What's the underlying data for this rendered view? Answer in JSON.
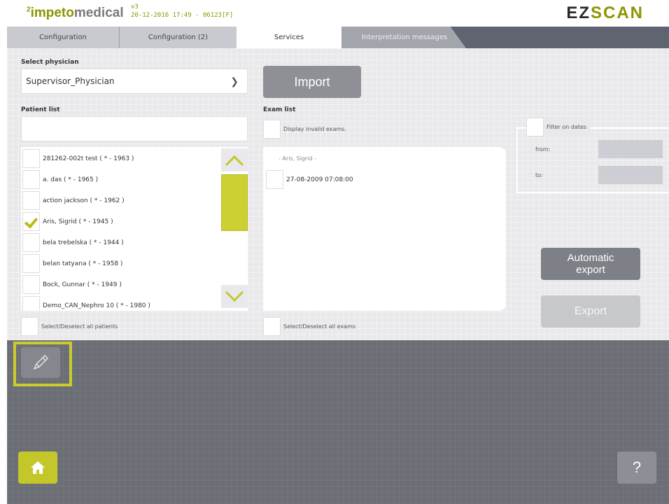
{
  "header": {
    "brand_super": "2",
    "brand_main": "impeto",
    "brand_tail": "medical",
    "version": "v3",
    "datetime": "20-12-2016 17:49  -  06123[F]",
    "product_ez": "EZ",
    "product_scan": "SCAN"
  },
  "tabs": [
    {
      "label": "Configuration",
      "active": false
    },
    {
      "label": "Configuration (2)",
      "active": false
    },
    {
      "label": "Services",
      "active": true
    },
    {
      "label": "Interpretation messages",
      "active": false
    }
  ],
  "physician": {
    "label": "Select physician",
    "value": "Supervisor_Physician"
  },
  "import_label": "Import",
  "patient_list": {
    "label": "Patient list",
    "search_value": "",
    "rows": [
      {
        "name": "281262-002t test ( * - 1963 )",
        "checked": false
      },
      {
        "name": "a. das  ( * - 1965 )",
        "checked": false
      },
      {
        "name": "action jackson  ( * - 1962 )",
        "checked": false
      },
      {
        "name": "Aris, Sigrid  ( * - 1945 )",
        "checked": true
      },
      {
        "name": "bela trebelska  ( * - 1944 )",
        "checked": false
      },
      {
        "name": "belan tatyana  ( * - 1958 )",
        "checked": false
      },
      {
        "name": "Bock, Gunnar  ( * - 1949 )",
        "checked": false
      },
      {
        "name": "Demo_CAN_Nephro 10 ( * - 1980 )",
        "checked": false
      }
    ],
    "select_all": "Select/Deselect all patients"
  },
  "exam_list": {
    "label": "Exam list",
    "invalid_label": "Display invalid exams.",
    "group": "- Aris, Sigrid  -",
    "exams": [
      {
        "date": "27-08-2009 07:08:00",
        "checked": false
      }
    ],
    "select_all": "Select/Deselect all exams"
  },
  "filter": {
    "label": "Filter on dates",
    "from_label": "from:",
    "to_label": "to:",
    "from_value": "",
    "to_value": ""
  },
  "auto_export_label": "Automatic\nexport",
  "export_label": "Export",
  "help_label": "?",
  "colors": {
    "accent": "#c3c72a",
    "brand": "#8d9400"
  }
}
